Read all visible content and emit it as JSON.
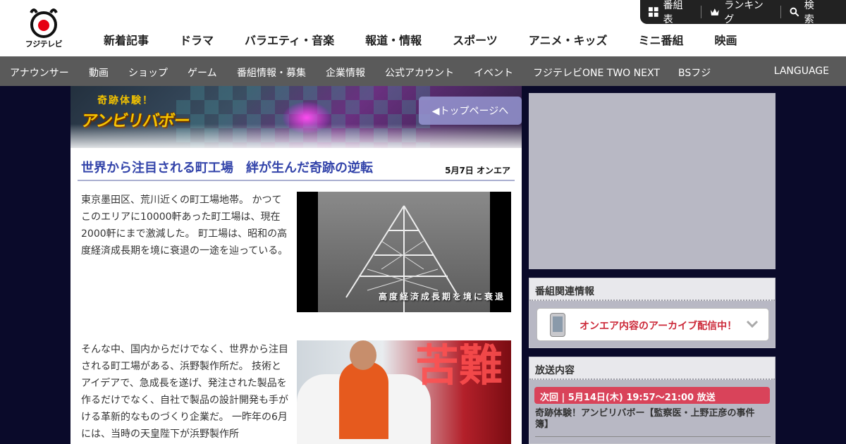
{
  "logo": {
    "text": "フジテレビ"
  },
  "utility": [
    {
      "label": "番組表",
      "icon": "grid-icon"
    },
    {
      "label": "ランキング",
      "icon": "crown-icon"
    },
    {
      "label": "検索",
      "icon": "search-icon"
    }
  ],
  "main_nav": [
    "新着記事",
    "ドラマ",
    "バラエティ・音楽",
    "報道・情報",
    "スポーツ",
    "アニメ・キッズ",
    "ミニ番組",
    "映画"
  ],
  "sub_nav": [
    "アナウンサー",
    "動画",
    "ショップ",
    "ゲーム",
    "番組情報・募集",
    "企業情報",
    "公式アカウント",
    "イベント",
    "フジテレビONE TWO NEXT",
    "BSフジ"
  ],
  "language": "LANGUAGE",
  "banner": {
    "subtitle": "奇跡体験！",
    "title": "アンビリバボー",
    "top_button": "◀トップページへ"
  },
  "article": {
    "title": "世界から注目される町工場　絆が生んだ奇跡の逆転",
    "onair": "5月7日 オンエア",
    "para1": "東京墨田区、荒川近くの町工場地帯。 かつてこのエリアに10000軒あった町工場は、現在2000軒にまで激減した。 町工場は、昭和の高度経済成長期を境に衰退の一途を辿っている。",
    "image1_caption": "高度経済成長期を境に衰退",
    "para2": "そんな中、国内からだけでなく、世界から注目される町工場がある、浜野製作所だ。 技術とアイデアで、急成長を遂げ、発注された製品を作るだけでなく、自社で製品の設計開発も手がける革新的なものづくり企業だ。 一昨年の6月には、当時の天皇陛下が浜野製作所",
    "image2_text": "苦難"
  },
  "sidebar": {
    "related_head": "番組関連情報",
    "archive_label": "オンエア内容のアーカイブ配信中！",
    "broadcast_head": "放送内容",
    "next_badge": "次回 | 5月14日(木) 19:57～21:00 放送",
    "next_title": "奇跡体験！アンビリバボー【監察医・上野正彦の事件簿】"
  }
}
